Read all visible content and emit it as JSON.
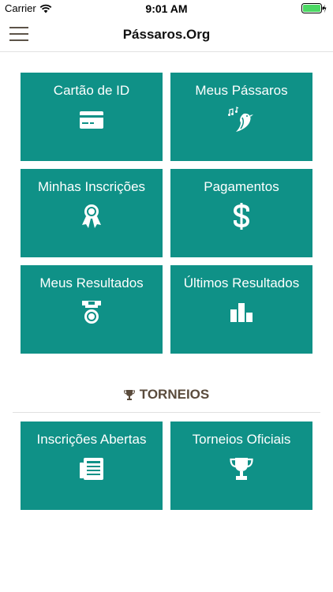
{
  "status_bar": {
    "carrier": "Carrier",
    "time": "9:01 AM"
  },
  "nav": {
    "title": "Pássaros.Org"
  },
  "tiles": [
    {
      "label": "Cartão de ID",
      "icon": "id-card-icon"
    },
    {
      "label": "Meus Pássaros",
      "icon": "bird-icon"
    },
    {
      "label": "Minhas Inscrições",
      "icon": "ribbon-award-icon"
    },
    {
      "label": "Pagamentos",
      "icon": "dollar-icon"
    },
    {
      "label": "Meus Resultados",
      "icon": "medal-icon"
    },
    {
      "label": "Últimos Resultados",
      "icon": "podium-icon"
    }
  ],
  "torneios": {
    "heading": "TORNEIOS",
    "tiles": [
      {
        "label": "Inscrições Abertas",
        "icon": "newspaper-icon"
      },
      {
        "label": "Torneios Oficiais",
        "icon": "trophy-icon"
      }
    ]
  },
  "colors": {
    "tile": "#0f9187",
    "heading": "#5a4b3c",
    "battery": "#4cd964"
  }
}
